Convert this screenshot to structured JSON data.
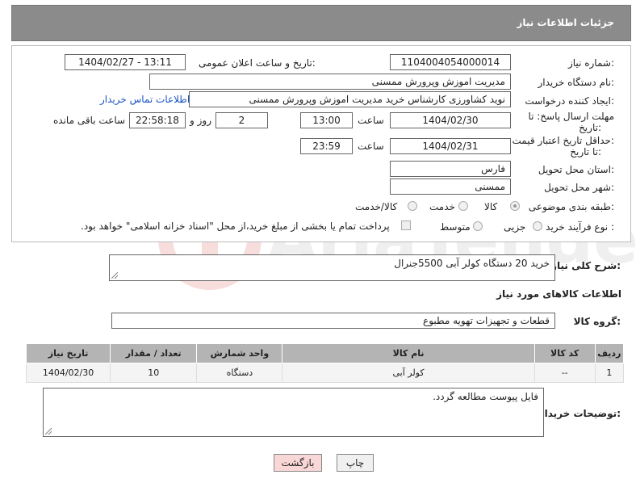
{
  "header": {
    "title": "جزئیات اطلاعات نیاز"
  },
  "form": {
    "need_number_label": "شماره نیاز:",
    "need_number": "1104004054000014",
    "announce_label": "تاریخ و ساعت اعلان عمومی:",
    "announce_value": "1404/02/27 - 13:11",
    "buyer_org_label": "نام دستگاه خریدار:",
    "buyer_org": "مدیریت اموزش وپرورش ممسنی",
    "creator_label": "ایجاد کننده درخواست:",
    "creator": "نوید کشاورزی کارشناس خرید مدیریت اموزش وپرورش ممسنی",
    "contact_link": "اطلاعات تماس خریدار",
    "deadline_label_1": "مهلت ارسال پاسخ: تا",
    "deadline_label_2": "تاریخ:",
    "deadline_date": "1404/02/30",
    "time_label": "ساعت",
    "deadline_time": "13:00",
    "days_value": "2",
    "days_label": "روز و",
    "remaining_time": "22:58:18",
    "remaining_label": "ساعت باقی مانده",
    "validity_label_1": "حداقل تاریخ اعتبار قیمت:",
    "validity_label_2": "تا تاریخ:",
    "validity_date": "1404/02/31",
    "validity_time_label": "ساعت",
    "validity_time": "23:59",
    "province_label": "استان محل تحویل:",
    "province": "فارس",
    "city_label": "شهر محل تحویل:",
    "city": "ممسنی",
    "category_label": "طبقه بندی موضوعی:",
    "category_options": [
      "کالا",
      "خدمت",
      "کالا/خدمت"
    ],
    "category_selected": "کالا",
    "process_label": "نوع فرآیند خرید :",
    "process_options": [
      "جزیی",
      "متوسط"
    ],
    "payment_note": "پرداخت تمام یا بخشی از مبلغ خرید،از محل \"اسناد خزانه اسلامی\" خواهد بود."
  },
  "description": {
    "label": "شرح کلی نیاز:",
    "value": "خرید 20 دستگاه کولر آبی 5500جنرال"
  },
  "goods": {
    "section_title": "اطلاعات کالاهای مورد نیاز",
    "group_label": "گروه کالا:",
    "group_value": "قطعات و تجهیزات تهویه مطبوع",
    "columns": [
      "ردیف",
      "کد کالا",
      "نام کالا",
      "واحد شمارش",
      "تعداد / مقدار",
      "تاریخ نیاز"
    ],
    "rows": [
      [
        "1",
        "--",
        "کولر آبی",
        "دستگاه",
        "10",
        "1404/02/30"
      ]
    ]
  },
  "buyer_notes": {
    "label": "توضیحات خریدار:",
    "value": "فایل پیوست مطالعه گردد."
  },
  "buttons": {
    "print": "چاپ",
    "back": "بازگشت"
  },
  "colors": {
    "header_bg": "#8b8b8b",
    "link": "#1a55c6",
    "back_btn_bg": "#f9d7d7"
  }
}
